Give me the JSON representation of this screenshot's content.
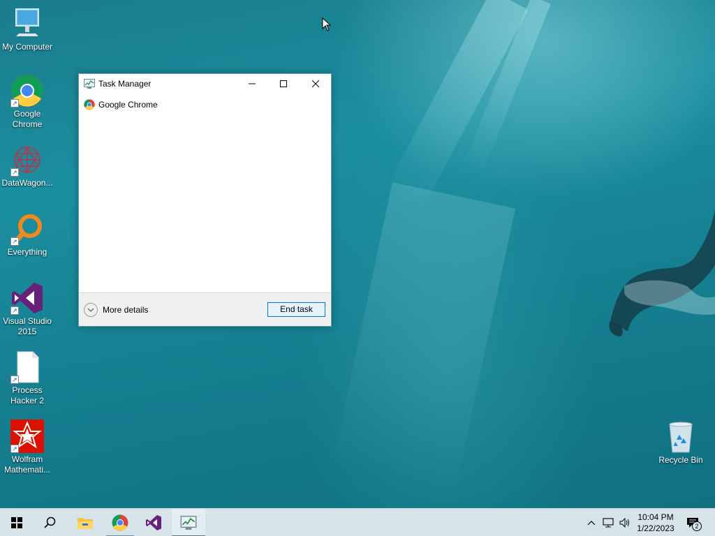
{
  "desktop": {
    "icons": [
      {
        "label": "My Computer",
        "icon": "computer-icon"
      },
      {
        "label": "Google Chrome",
        "icon": "chrome-icon"
      },
      {
        "label": "DataWagon...",
        "icon": "datawagon-icon"
      },
      {
        "label": "Everything",
        "icon": "everything-search-icon"
      },
      {
        "label": "Visual Studio 2015",
        "icon": "visual-studio-icon"
      },
      {
        "label": "Process Hacker 2",
        "icon": "file-icon"
      },
      {
        "label": "Wolfram Mathemati...",
        "icon": "wolfram-mathematica-icon"
      },
      {
        "label": "Recycle Bin",
        "icon": "recycle-bin-icon"
      }
    ]
  },
  "task_manager": {
    "title": "Task Manager",
    "apps": [
      {
        "label": "Google Chrome",
        "icon": "chrome-icon"
      }
    ],
    "more_details": "More details",
    "end_task": "End task"
  },
  "taskbar": {
    "pinned": [
      "windows-start-icon",
      "search-icon",
      "file-explorer-icon",
      "chrome-icon",
      "visual-studio-icon",
      "task-manager-icon"
    ],
    "tray": [
      "chevron-up-icon",
      "network-icon",
      "volume-icon"
    ],
    "clock": {
      "time": "10:04 PM",
      "date": "1/22/2023"
    },
    "notifications": {
      "count": "2"
    }
  },
  "colors": {
    "accent": "#0078d7",
    "taskbar": "#d6e4ea",
    "water": "#1b8fa0"
  }
}
